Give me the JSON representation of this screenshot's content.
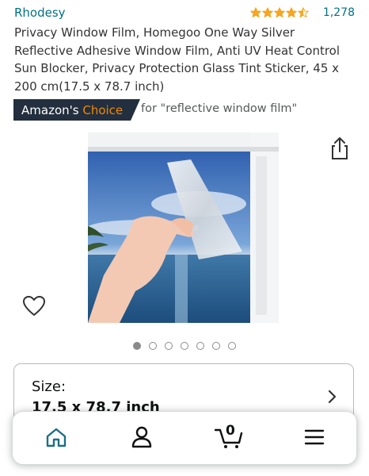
{
  "brand": "Rhodesy",
  "rating": {
    "stars": 4.5,
    "count": "1,278"
  },
  "title": "Privacy Window Film, Homegoo One Way Silver Reflective Adhesive Window Film, Anti UV Heat Control Sun Blocker, Privacy Protection Glass Tint Sticker, 45 x 200 cm(17.5 x 78.7 inch)",
  "badge": {
    "prefix": "Amazon's",
    "highlight": "Choice",
    "for_text": "for \"reflective window film\""
  },
  "gallery": {
    "image_count": 7,
    "active_index": 0
  },
  "size": {
    "label": "Size:",
    "value": "17.5 x 78.7 inch"
  },
  "cart": {
    "count": "0"
  },
  "icons": {
    "share": "share-icon",
    "wishlist": "heart-icon",
    "home": "home-icon",
    "account": "account-icon",
    "cart": "cart-icon",
    "menu": "menu-icon",
    "chevron": "chevron-right-icon"
  },
  "colors": {
    "link": "#007185",
    "star": "#f5a623",
    "badge_bg": "#232f3e",
    "badge_accent": "#f08804",
    "active_nav": "#1e6e86"
  }
}
